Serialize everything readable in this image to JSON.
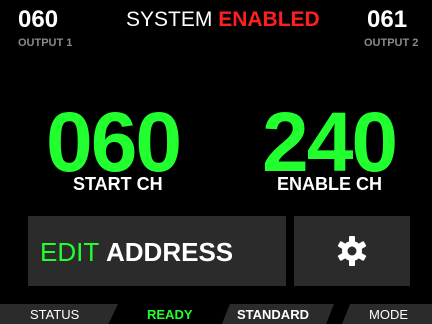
{
  "header": {
    "output1": {
      "value": "060",
      "label": "OUTPUT 1"
    },
    "output2": {
      "value": "061",
      "label": "OUTPUT 2"
    },
    "system_label": "SYSTEM",
    "system_state": "ENABLED"
  },
  "main": {
    "start": {
      "value": "060",
      "label": "START CH"
    },
    "enable": {
      "value": "240",
      "label": "ENABLE CH"
    }
  },
  "buttons": {
    "edit_prefix": "EDIT",
    "edit_main": "ADDRESS",
    "settings_icon": "gear-icon"
  },
  "status_bar": {
    "status_label": "STATUS",
    "ready_value": "READY",
    "profile_value": "STANDARD",
    "mode_label": "MODE"
  },
  "colors": {
    "background": "#000000",
    "accent_green": "#22ff2e",
    "alert_red": "#ff1f1f",
    "panel": "#2b2b2b",
    "muted": "#8a8a8a"
  }
}
